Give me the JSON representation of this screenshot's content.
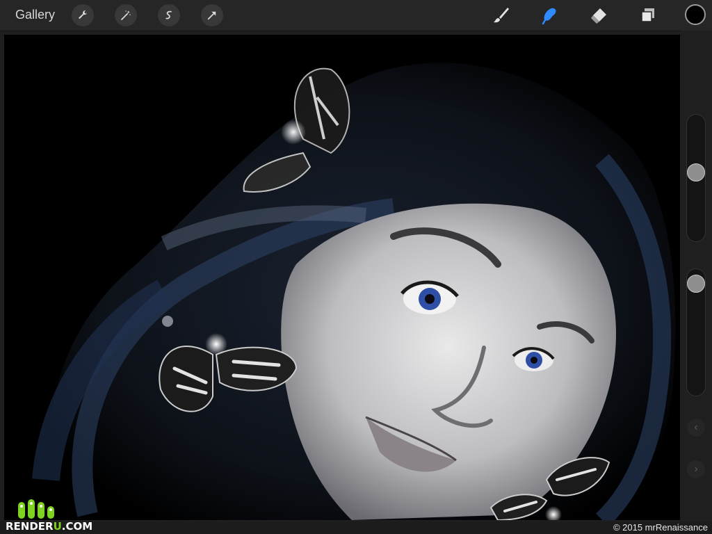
{
  "toolbar": {
    "gallery_label": "Gallery",
    "left_tools": [
      "wrench-icon",
      "magic-wand-icon",
      "selection-icon",
      "transform-icon"
    ],
    "right_tools": [
      "brush-icon",
      "smudge-icon",
      "eraser-icon",
      "layers-icon"
    ],
    "active_tool": "smudge-icon",
    "accent_color": "#2f8bff",
    "current_color": "#000000"
  },
  "sidebar": {
    "brush_size_level": 0.45,
    "opacity_level": 0.05
  },
  "footer": {
    "copyright": "© 2015 mrRenaissance"
  },
  "watermark": {
    "brand_a": "RENDER",
    "brand_b": "U",
    "brand_c": ".COM"
  }
}
